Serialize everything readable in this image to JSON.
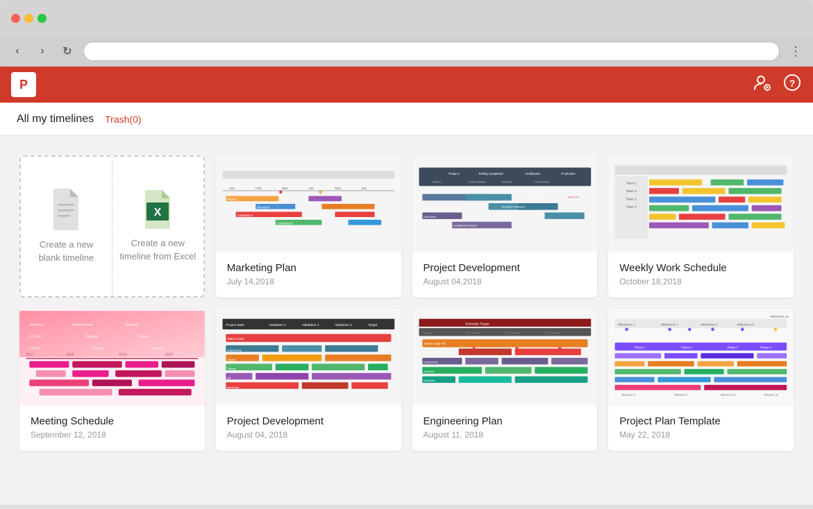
{
  "browser": {
    "address": "",
    "nav": {
      "back": "‹",
      "forward": "›",
      "refresh": "↻"
    }
  },
  "app": {
    "logo_letter": "P",
    "header_title": "All my timelines",
    "trash_label": "Trash(0)",
    "create_blank_label": "Create a new blank timeline",
    "create_excel_label": "Create a new timeline from Excel"
  },
  "timelines": [
    {
      "name": "Marketing Plan",
      "date": "July 14,2018",
      "preview_type": "marketing"
    },
    {
      "name": "Project Development",
      "date": "August 04,2018",
      "preview_type": "project_dev_1"
    },
    {
      "name": "Weekly Work Schedule",
      "date": "October 18,2018",
      "preview_type": "weekly_work"
    },
    {
      "name": "Meeting Schedule",
      "date": "September 12, 2018",
      "preview_type": "meeting"
    },
    {
      "name": "Project Development",
      "date": "August 04, 2018",
      "preview_type": "project_dev_2"
    },
    {
      "name": "Engineering Plan",
      "date": "August 11, 2018",
      "preview_type": "engineering"
    },
    {
      "name": "Project Plan Template",
      "date": "May 22, 2018",
      "preview_type": "project_plan"
    }
  ]
}
